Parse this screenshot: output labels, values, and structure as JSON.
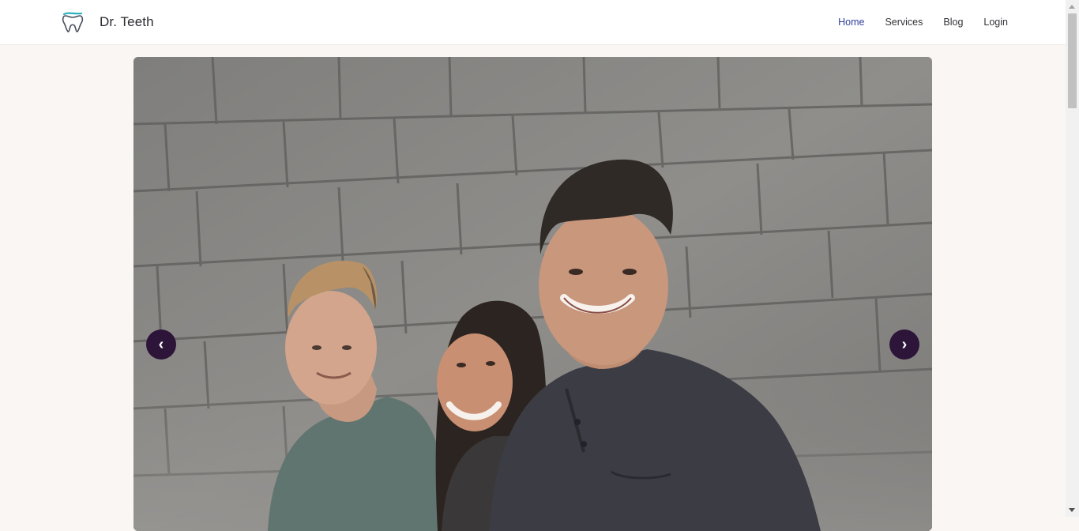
{
  "brand": {
    "name": "Dr. Teeth",
    "logo_icon": "tooth-icon"
  },
  "nav": {
    "items": [
      {
        "label": "Home",
        "active": true
      },
      {
        "label": "Services",
        "active": false
      },
      {
        "label": "Blog",
        "active": false
      },
      {
        "label": "Login",
        "active": false
      }
    ]
  },
  "carousel": {
    "image": "hero-photo",
    "prev_label": "‹",
    "next_label": "›"
  },
  "colors": {
    "accent": "#2d3f9c",
    "arrow_bg": "#2c1538",
    "page_bg": "#f9f6f3",
    "logo_teal": "#2bb3c0"
  }
}
